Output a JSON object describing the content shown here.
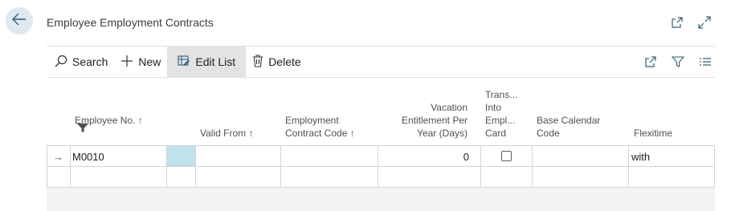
{
  "page": {
    "title": "Employee Employment Contracts"
  },
  "icons": {
    "back": "back-arrow-icon",
    "open_new": "open-in-new-window-icon",
    "expand": "expand-icon",
    "search": "search-icon",
    "new": "plus-icon",
    "edit_list": "edit-list-icon",
    "delete": "trash-icon",
    "share": "share-icon",
    "filter": "filter-icon",
    "list": "list-view-icon"
  },
  "actions": {
    "search": "Search",
    "new": "New",
    "edit_list": "Edit List",
    "delete": "Delete"
  },
  "columns": {
    "employee_no": "Employee No. ↑",
    "valid_from": "Valid From ↑",
    "contract_code_1": "Employment",
    "contract_code_2": "Contract Code ↑",
    "vacation_1": "Vacation",
    "vacation_2": "Entitlement Per",
    "vacation_3": "Year (Days)",
    "transfer_1": "Trans...",
    "transfer_2": "Into",
    "transfer_3": "Empl...",
    "transfer_4": "Card",
    "calendar_1": "Base Calendar",
    "calendar_2": "Code",
    "flexitime": "Flexitime"
  },
  "rows": [
    {
      "indicator": "→",
      "employee_no": "M0010",
      "valid_from": "",
      "contract_code": "",
      "vacation_days": "0",
      "transfer_into_card": false,
      "base_calendar_code": "",
      "flexitime": "with"
    },
    {
      "indicator": "",
      "employee_no": "",
      "valid_from": "",
      "contract_code": "",
      "vacation_days": "",
      "transfer_into_card": false,
      "base_calendar_code": "",
      "flexitime": ""
    }
  ],
  "colors": {
    "accent_highlight": "#bfe3ec",
    "back_button_bg": "#dfe9ef",
    "active_action_bg": "#e3e3e3"
  }
}
